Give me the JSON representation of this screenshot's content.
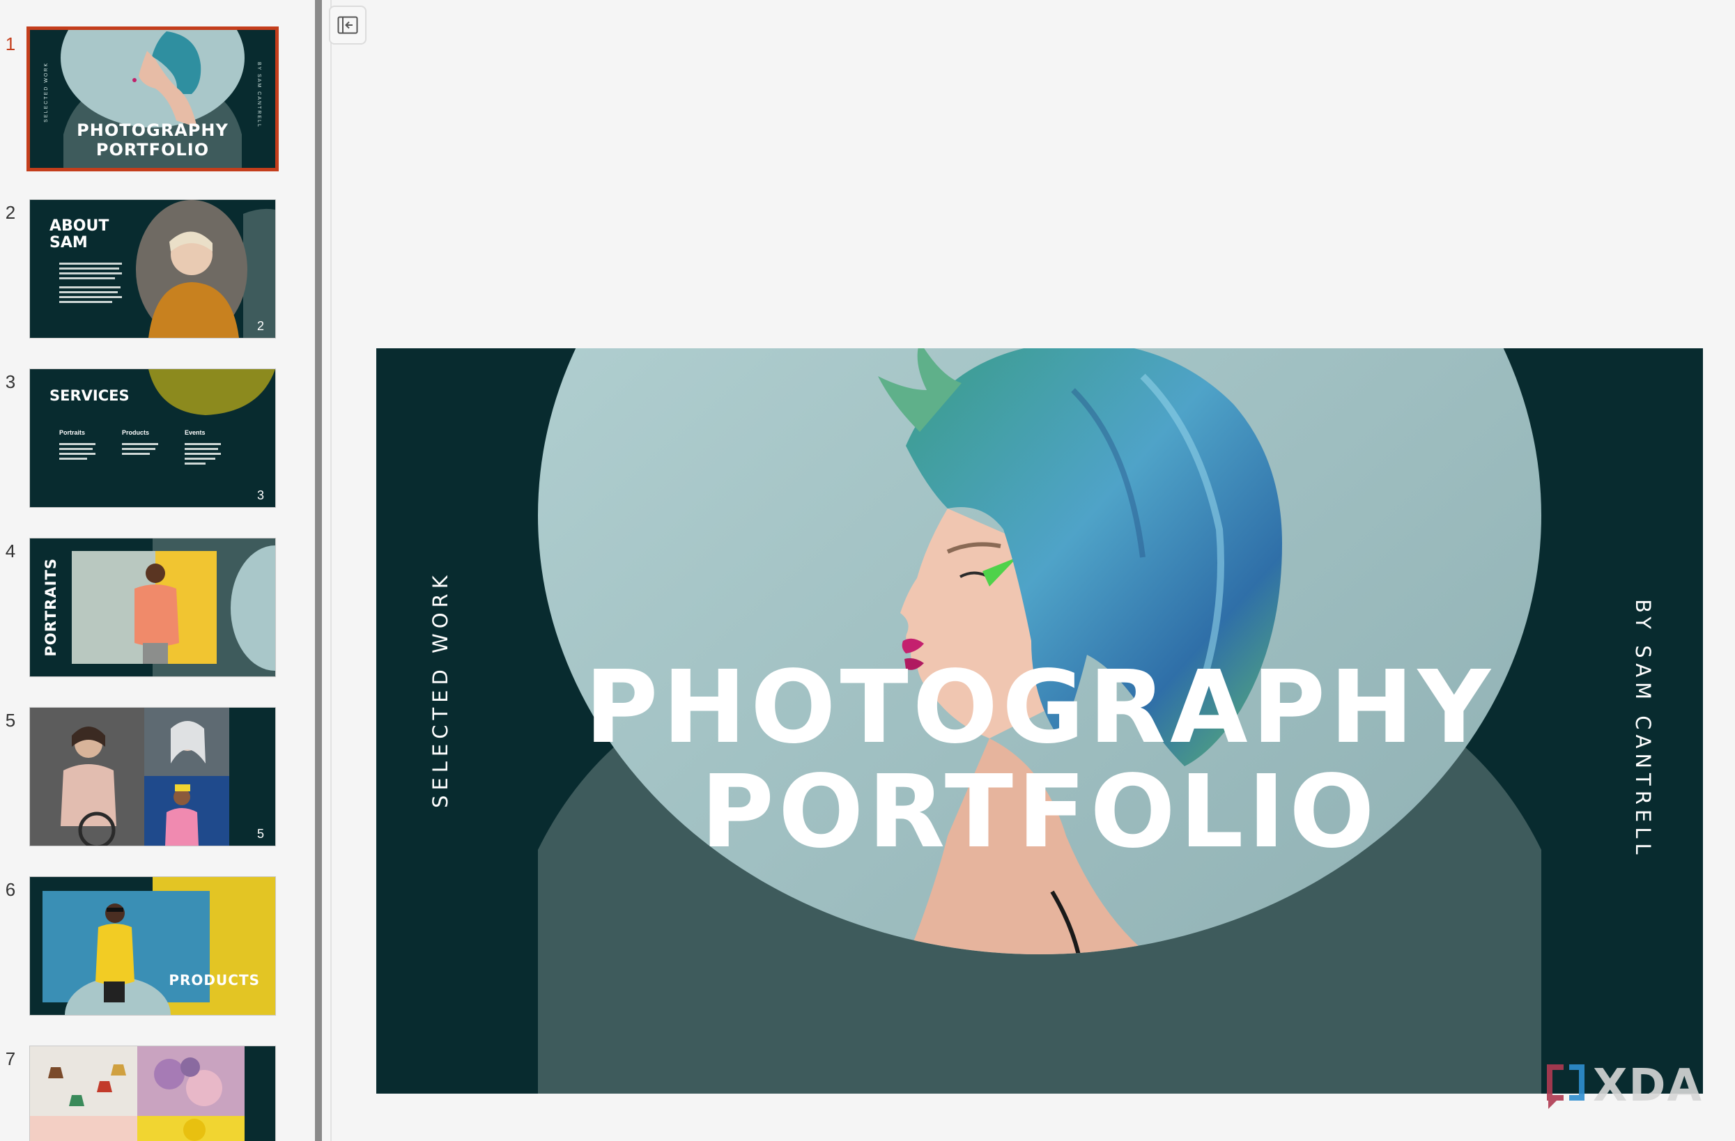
{
  "sidebar": {
    "thumbnails": [
      {
        "number": "1",
        "title_line1": "PHOTOGRAPHY",
        "title_line2": "PORTFOLIO",
        "left_label": "SELECTED WORK",
        "right_label": "BY SAM CANTRELL",
        "selected": true
      },
      {
        "number": "2",
        "heading_line1": "ABOUT",
        "heading_line2": "SAM",
        "page": "2"
      },
      {
        "number": "3",
        "heading": "SERVICES",
        "col1": "Portraits",
        "col2": "Products",
        "col3": "Events",
        "page": "3"
      },
      {
        "number": "4",
        "heading": "PORTRAITS"
      },
      {
        "number": "5",
        "page": "5"
      },
      {
        "number": "6",
        "heading": "PRODUCTS"
      },
      {
        "number": "7"
      }
    ]
  },
  "toolbar": {
    "collapse_icon": "collapse-pane-icon"
  },
  "slide": {
    "title_line1": "PHOTOGRAPHY",
    "title_line2": "PORTFOLIO",
    "left_label": "SELECTED WORK",
    "right_label": "BY SAM CANTRELL"
  },
  "watermark": {
    "text": "XDA"
  },
  "colors": {
    "slide_bg": "#082b2f",
    "arch": "#3e5b5c",
    "circle": "#a9c7c9",
    "accent_selected": "#c43e1c",
    "yellow": "#e3c524"
  }
}
